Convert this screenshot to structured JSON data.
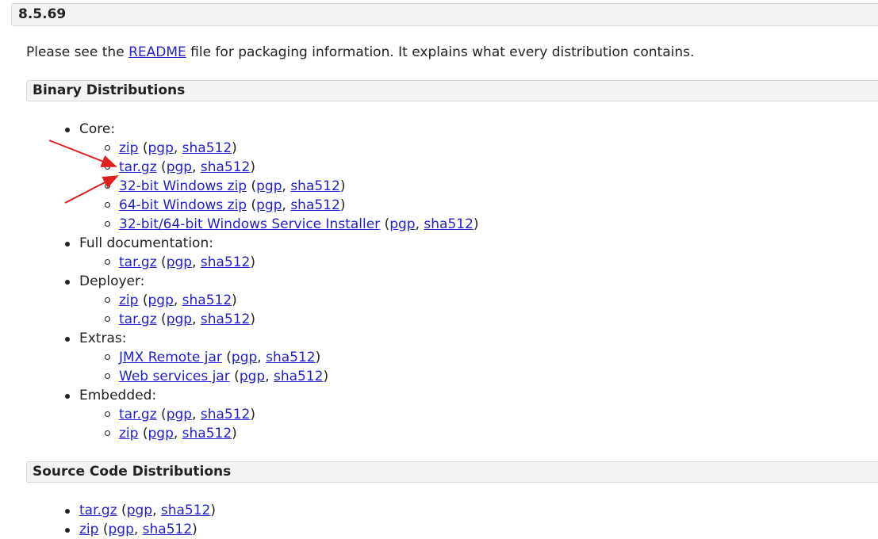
{
  "version": "8.5.69",
  "intro": {
    "before": "Please see the ",
    "link": "README",
    "after": " file for packaging information. It explains what every distribution contains."
  },
  "binary": {
    "title": "Binary Distributions",
    "groups": [
      {
        "label": "Core:",
        "items": [
          {
            "name": "zip",
            "pgp": "pgp",
            "sha": "sha512"
          },
          {
            "name": "tar.gz",
            "pgp": "pgp",
            "sha": "sha512"
          },
          {
            "name": "32-bit Windows zip",
            "pgp": "pgp",
            "sha": "sha512"
          },
          {
            "name": "64-bit Windows zip",
            "pgp": "pgp",
            "sha": "sha512"
          },
          {
            "name": "32-bit/64-bit Windows Service Installer",
            "pgp": "pgp",
            "sha": "sha512"
          }
        ]
      },
      {
        "label": "Full documentation:",
        "items": [
          {
            "name": "tar.gz",
            "pgp": "pgp",
            "sha": "sha512"
          }
        ]
      },
      {
        "label": "Deployer:",
        "items": [
          {
            "name": "zip",
            "pgp": "pgp",
            "sha": "sha512"
          },
          {
            "name": "tar.gz",
            "pgp": "pgp",
            "sha": "sha512"
          }
        ]
      },
      {
        "label": "Extras:",
        "items": [
          {
            "name": "JMX Remote jar",
            "pgp": "pgp",
            "sha": "sha512"
          },
          {
            "name": "Web services jar",
            "pgp": "pgp",
            "sha": "sha512"
          }
        ]
      },
      {
        "label": "Embedded:",
        "items": [
          {
            "name": "tar.gz",
            "pgp": "pgp",
            "sha": "sha512"
          },
          {
            "name": "zip",
            "pgp": "pgp",
            "sha": "sha512"
          }
        ]
      }
    ]
  },
  "source": {
    "title": "Source Code Distributions",
    "items": [
      {
        "name": "tar.gz",
        "pgp": "pgp",
        "sha": "sha512"
      },
      {
        "name": "zip",
        "pgp": "pgp",
        "sha": "sha512"
      }
    ]
  },
  "punct": {
    "open": " (",
    "comma": ", ",
    "close": ")"
  },
  "colors": {
    "link": "#2222cc",
    "annotation_arrow": "#e02020",
    "header_bg": "#f3f3f3"
  }
}
